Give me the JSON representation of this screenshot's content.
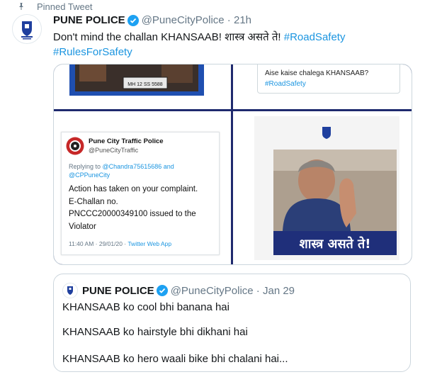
{
  "pinned": {
    "label": "Pinned Tweet"
  },
  "tweet": {
    "name": "PUNE POLICE",
    "handle": "@PuneCityPolice",
    "time": "21h",
    "text": "Don't mind the challan KHANSAAB! शास्त्र असते ते!",
    "hashtag1": "#RoadSafety",
    "hashtag2": "#RulesForSafety"
  },
  "media": {
    "tl_plate": "MH 12 SS 5588",
    "tr_text": "Aise kaise chalega KHANSAAB?",
    "tr_hashtag": "#RoadSafety",
    "bl": {
      "account_name": "Pune City Traffic Police",
      "account_handle": "@PuneCityTraffic",
      "replying_prefix": "Replying to ",
      "replying_handles": "@Chandra75615686 and @CPPuneCity",
      "body_line1": "Action has taken on your complaint.",
      "body_line2": "E-Challan no.",
      "body_line3": "PNCCC20000349100 issued to the",
      "body_line4": "Violator",
      "meta_time": "11:40 AM · 29/01/20 · ",
      "meta_client": "Twitter Web App"
    },
    "br_caption": "शास्त्र असते ते!"
  },
  "quote": {
    "name": "PUNE POLICE",
    "handle": "@PuneCityPolice",
    "date": "Jan 29",
    "line1": "KHANSAAB ko cool bhi banana hai",
    "line2": "KHANSAAB ko hairstyle bhi dikhani hai",
    "line3": "KHANSAAB ko hero waali bike bhi chalani hai..."
  },
  "colors": {
    "accent": "#1b95e0",
    "panel_blue": "#1f4fb0",
    "divider": "#1f2a6e"
  }
}
